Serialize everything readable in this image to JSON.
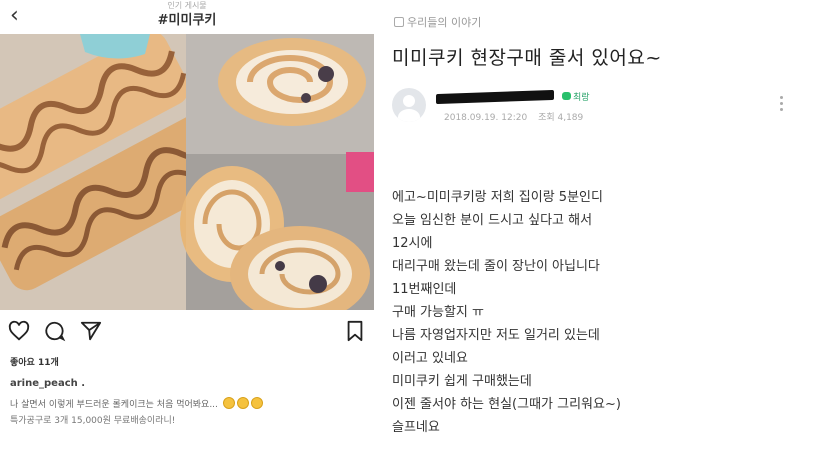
{
  "instagram": {
    "top_sub": "인기 게시물",
    "hashtag": "#미미쿠키",
    "likes": "좋아요 11개",
    "username": "arine_peach .",
    "caption_line1": "나 살면서 이렇게 부드러운 롤케이크는 처음 먹어봐요...",
    "caption_line2": "특가공구로 3개 15,000원 무료배송이라니!",
    "icons": [
      "back-icon",
      "heart-icon",
      "comment-icon",
      "send-icon",
      "bookmark-icon",
      "emoji-icon"
    ]
  },
  "article": {
    "board": "우리들의 이야기",
    "title": "미미쿠키 현장구매 줄서 있어요~",
    "author_level": "최랑",
    "date": "2018.09.19. 12:20",
    "views": "조회 4,189",
    "body_lines": [
      "에고~미미쿠키랑 저희 집이랑 5분인디",
      "오늘 임신한 분이 드시고 싶다고 해서",
      "12시에",
      "대리구매 왔는데 줄이 장난이 아닙니다",
      "11번째인데",
      "구매 가능할지 ㅠ",
      "나름 자영업자지만 저도 일거리 있는데",
      "이러고 있네요",
      "미미쿠키 쉽게 구매했는데",
      "이젠 줄서야 하는 현실(그때가 그리워요~)",
      "슬프네요"
    ]
  },
  "colors": {
    "accent_green": "#29c06c",
    "text_dark": "#222222",
    "text_muted": "#999999"
  }
}
